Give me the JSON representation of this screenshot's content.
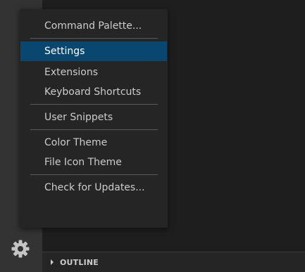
{
  "activity_bar": {
    "manage_icon": "gear-icon"
  },
  "panel": {
    "outline_label": "OUTLINE",
    "chevron_icon": "chevron-right-icon"
  },
  "menu": {
    "groups": [
      [
        "Command Palette..."
      ],
      [
        "Settings",
        "Extensions",
        "Keyboard Shortcuts"
      ],
      [
        "User Snippets"
      ],
      [
        "Color Theme",
        "File Icon Theme"
      ],
      [
        "Check for Updates..."
      ]
    ],
    "highlighted": "Settings"
  },
  "colors": {
    "highlight": "#094771",
    "menu_bg": "#252526",
    "activity_bar_bg": "#333333",
    "editor_bg": "#1e1e1e"
  }
}
